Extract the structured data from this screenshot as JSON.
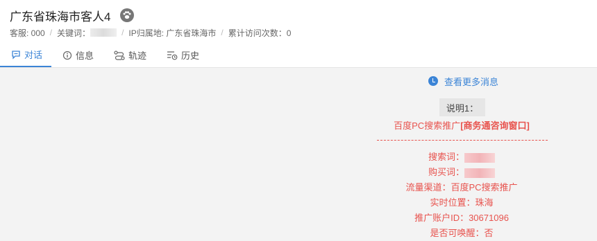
{
  "header": {
    "title": "广东省珠海市客人4",
    "meta": {
      "agent": "客服: 000",
      "keyword_label": "关键词：",
      "ip_location": "IP归属地: 广东省珠海市",
      "visit_count": "累计访问次数：0"
    }
  },
  "tabs": [
    {
      "label": "对话",
      "icon": "chat-icon",
      "active": true
    },
    {
      "label": "信息",
      "icon": "info-icon",
      "active": false
    },
    {
      "label": "轨迹",
      "icon": "track-icon",
      "active": false
    },
    {
      "label": "历史",
      "icon": "history-icon",
      "active": false
    }
  ],
  "chat": {
    "more_link": "查看更多消息",
    "note_label": "说明1：",
    "source_prefix": "百度PC搜索推广",
    "source_window": "[商务通咨询窗口]",
    "divider": "----------------------------------",
    "search_word_label": "搜索词：",
    "purchase_word_label": "购买词：",
    "channel": "流量渠道：百度PC搜索推广",
    "location": "实时位置：珠海",
    "account_id": "推广账户ID：30671096",
    "awake": "是否可唤醒：否"
  },
  "colors": {
    "accent": "#3b84d6",
    "message_red": "#e8534e",
    "chat_bg": "#f3f3f3"
  }
}
